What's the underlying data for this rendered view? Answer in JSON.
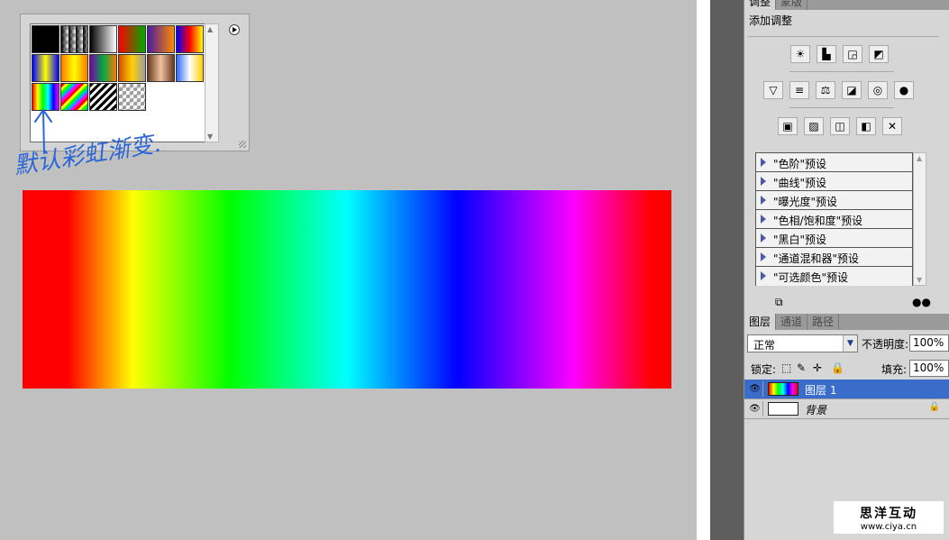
{
  "picker": {
    "swatches": [
      {
        "bg": "linear-gradient(to right,#000,#000)"
      },
      {
        "bg": "linear-gradient(to right,#000,rgba(0,0,0,0))",
        "checker": true
      },
      {
        "bg": "linear-gradient(to right,#000,#fff)"
      },
      {
        "bg": "linear-gradient(to right,#ff0000,#00aa00)"
      },
      {
        "bg": "linear-gradient(to right,#4a1aa0,#ff8a00)"
      },
      {
        "bg": "linear-gradient(to right,#0000ff,#ff0000,#ffff00)"
      },
      {
        "bg": "linear-gradient(to right,#0000ff,#ffff00,#0000ff)"
      },
      {
        "bg": "linear-gradient(to right,#ff7a00,#ffff00,#ff7a00)"
      },
      {
        "bg": "linear-gradient(to right,#7a00aa,#00aa44,#ff7a00)"
      },
      {
        "bg": "linear-gradient(to right,#d05000,#ffd000,#a0a0a0)"
      },
      {
        "bg": "linear-gradient(to right,#6a3a20,#f0c0a0,#6a3a20)"
      },
      {
        "bg": "linear-gradient(to right,#2a6aff,#ffffff,#ffd000)"
      },
      {
        "bg": "linear-gradient(to right,#ff0000,#ffff00,#00ff00,#00ffff,#0000ff,#ff00ff)"
      },
      {
        "bg": "repeating-linear-gradient(135deg,#ff0000 0 3px,#ffff00 3px 6px,#00ff00 6px 9px,#00aaff 9px 12px,#ff00ff 12px 15px)"
      },
      {
        "bg": "repeating-linear-gradient(135deg,#000 0 3px,#fff 3px 6px)"
      },
      {
        "bg": "repeating-linear-gradient(135deg,rgba(0,0,0,0) 0 4px,rgba(0,0,0,0.15) 4px 8px)",
        "checker": true
      }
    ],
    "annotation": "默认彩虹渐变."
  },
  "adjust": {
    "tabs": [
      "调整",
      "蒙版"
    ],
    "title": "添加调整",
    "row1": [
      "☀",
      "▙",
      "◲",
      "◩"
    ],
    "row2": [
      "▽",
      "≡",
      "⚖",
      "◪",
      "◎",
      "●"
    ],
    "row3": [
      "▣",
      "▨",
      "◫",
      "◧",
      "✕"
    ],
    "presets": [
      "\"色阶\"预设",
      "\"曲线\"预设",
      "\"曝光度\"预设",
      "\"色相/饱和度\"预设",
      "\"黑白\"预设",
      "\"通道混和器\"预设",
      "\"可选颜色\"预设"
    ]
  },
  "layers": {
    "tabs": [
      "图层",
      "通道",
      "路径"
    ],
    "blend_mode": "正常",
    "opacity_label": "不透明度:",
    "opacity_value": "100%",
    "lock_label": "锁定:",
    "fill_label": "填充:",
    "fill_value": "100%",
    "items": [
      {
        "name": "图层 1",
        "selected": true,
        "thumb": "rainbow"
      },
      {
        "name": "背景",
        "selected": false,
        "thumb": "white"
      }
    ]
  },
  "watermark": {
    "line1": "思洋互动",
    "line2": "www.ciya.cn"
  },
  "colors": {
    "panel_bg": "#d6d6d6",
    "selection": "#3a6dca",
    "canvas_bg": "#c0c0c0",
    "annotation": "#2a66d8"
  }
}
